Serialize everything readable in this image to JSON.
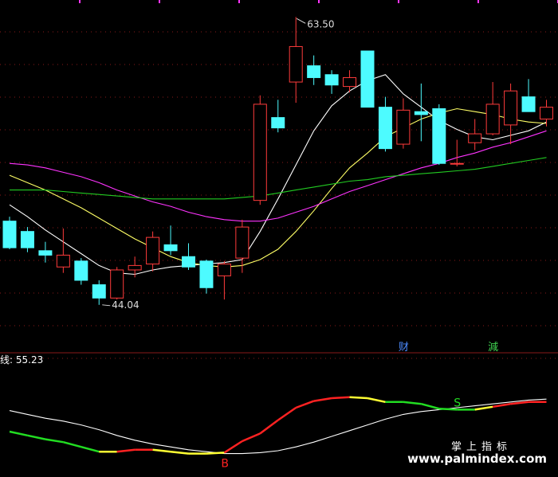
{
  "chart_data": [
    {
      "type": "candlestick",
      "title": "",
      "colors": {
        "up": "#ff3b3b",
        "down": "#4dfbff",
        "ma5": "#ffffff",
        "ma10": "#ffff66",
        "ma20": "#ff33ff",
        "ma60": "#22cc22",
        "grid": "#8a1a1a"
      },
      "annotations": {
        "high_label": "63.50",
        "low_label": "44.04"
      },
      "event_badges": [
        {
          "label": "财",
          "index": 22,
          "color": "#4d8bff"
        },
        {
          "label": "減",
          "index": 27,
          "color": "#3fd04f"
        }
      ],
      "ylim": [
        41.5,
        64.0
      ],
      "candles": [
        {
          "o": 49.7,
          "h": 50.0,
          "l": 47.8,
          "c": 47.9
        },
        {
          "o": 49.0,
          "h": 49.3,
          "l": 47.6,
          "c": 47.9
        },
        {
          "o": 47.7,
          "h": 48.3,
          "l": 46.9,
          "c": 47.4
        },
        {
          "o": 46.6,
          "h": 49.2,
          "l": 46.2,
          "c": 47.4
        },
        {
          "o": 47.0,
          "h": 47.2,
          "l": 45.4,
          "c": 45.7
        },
        {
          "o": 45.4,
          "h": 45.7,
          "l": 44.04,
          "c": 44.5
        },
        {
          "o": 44.5,
          "h": 46.6,
          "l": 44.4,
          "c": 46.4
        },
        {
          "o": 46.4,
          "h": 47.3,
          "l": 45.9,
          "c": 46.7
        },
        {
          "o": 46.8,
          "h": 49.0,
          "l": 46.3,
          "c": 48.6
        },
        {
          "o": 48.1,
          "h": 49.4,
          "l": 47.4,
          "c": 47.7
        },
        {
          "o": 47.3,
          "h": 48.2,
          "l": 46.4,
          "c": 46.6
        },
        {
          "o": 47.0,
          "h": 47.1,
          "l": 44.8,
          "c": 45.2
        },
        {
          "o": 46.0,
          "h": 47.0,
          "l": 44.4,
          "c": 46.8
        },
        {
          "o": 47.2,
          "h": 49.8,
          "l": 46.2,
          "c": 49.3
        },
        {
          "o": 51.1,
          "h": 58.2,
          "l": 50.8,
          "c": 57.6
        },
        {
          "o": 56.7,
          "h": 57.9,
          "l": 55.7,
          "c": 56.0
        },
        {
          "o": 59.1,
          "h": 63.5,
          "l": 57.7,
          "c": 61.5
        },
        {
          "o": 60.2,
          "h": 60.9,
          "l": 58.9,
          "c": 59.4
        },
        {
          "o": 59.6,
          "h": 59.9,
          "l": 58.3,
          "c": 58.9
        },
        {
          "o": 58.8,
          "h": 59.9,
          "l": 58.4,
          "c": 59.4
        },
        {
          "o": 61.2,
          "h": 61.2,
          "l": 57.4,
          "c": 57.4
        },
        {
          "o": 57.4,
          "h": 58.1,
          "l": 54.4,
          "c": 54.6
        },
        {
          "o": 54.9,
          "h": 58.0,
          "l": 54.6,
          "c": 57.2
        },
        {
          "o": 57.1,
          "h": 59.0,
          "l": 55.1,
          "c": 56.9
        },
        {
          "o": 57.3,
          "h": 57.6,
          "l": 53.5,
          "c": 53.6
        },
        {
          "o": 53.6,
          "h": 55.2,
          "l": 53.4,
          "c": 53.6
        },
        {
          "o": 55.0,
          "h": 56.6,
          "l": 54.5,
          "c": 55.6
        },
        {
          "o": 55.6,
          "h": 59.1,
          "l": 55.5,
          "c": 57.6
        },
        {
          "o": 56.2,
          "h": 59.0,
          "l": 54.9,
          "c": 58.5
        },
        {
          "o": 58.1,
          "h": 59.3,
          "l": 57.1,
          "c": 57.1
        },
        {
          "o": 56.6,
          "h": 57.9,
          "l": 56.1,
          "c": 57.4
        }
      ],
      "series": [
        {
          "key": "ma5",
          "values": [
            50.8,
            50.0,
            49.1,
            48.3,
            47.5,
            46.7,
            46.2,
            46.1,
            46.4,
            46.6,
            46.7,
            46.8,
            46.9,
            47.1,
            49.0,
            51.2,
            53.5,
            55.8,
            57.5,
            58.5,
            59.2,
            59.6,
            58.3,
            57.4,
            56.5,
            55.9,
            55.4,
            55.2,
            55.5,
            55.8,
            56.4
          ]
        },
        {
          "key": "ma10",
          "values": [
            52.8,
            52.3,
            51.8,
            51.2,
            50.6,
            49.9,
            49.2,
            48.5,
            47.9,
            47.3,
            46.9,
            46.7,
            46.6,
            46.7,
            47.1,
            47.8,
            49.0,
            50.4,
            51.9,
            53.3,
            54.3,
            55.4,
            56.0,
            56.6,
            57.0,
            57.3,
            57.1,
            56.9,
            56.6,
            56.4,
            56.3
          ]
        },
        {
          "key": "ma20",
          "values": [
            53.6,
            53.5,
            53.3,
            53.0,
            52.7,
            52.3,
            51.8,
            51.4,
            51.0,
            50.7,
            50.3,
            50.0,
            49.8,
            49.7,
            49.7,
            49.9,
            50.3,
            50.7,
            51.2,
            51.7,
            52.1,
            52.5,
            52.9,
            53.3,
            53.6,
            54.0,
            54.3,
            54.7,
            55.0,
            55.4,
            55.8
          ]
        },
        {
          "key": "ma60",
          "values": [
            51.8,
            51.8,
            51.8,
            51.7,
            51.6,
            51.5,
            51.4,
            51.3,
            51.2,
            51.2,
            51.2,
            51.2,
            51.2,
            51.3,
            51.4,
            51.6,
            51.8,
            52.0,
            52.2,
            52.4,
            52.5,
            52.7,
            52.8,
            52.9,
            53.0,
            53.1,
            53.2,
            53.4,
            53.6,
            53.8,
            54.0
          ]
        }
      ]
    },
    {
      "type": "line",
      "title": "",
      "value_label": "线: 55.23",
      "ylim": [
        0,
        100
      ],
      "signals": [
        {
          "label": "B",
          "index": 12,
          "value": 18,
          "color": "#ff2222",
          "position": "below"
        },
        {
          "label": "S",
          "index": 25,
          "value": 63,
          "color": "#22dd22",
          "position": "above"
        }
      ],
      "series": [
        {
          "key": "signal",
          "segment_colors": [
            "#22dd22",
            "#22dd22",
            "#22dd22",
            "#22dd22",
            "#22dd22",
            "#ffff33",
            "#ff2222",
            "#ff2222",
            "#ffff33",
            "#ffff33",
            "#ffff33",
            "#ffff33",
            "#ff2222",
            "#ff2222",
            "#ff2222",
            "#ff2222",
            "#ff2222",
            "#ff2222",
            "#ff2222",
            "#ffff33",
            "#ffff33",
            "#22dd22",
            "#22dd22",
            "#22dd22",
            "#22dd22",
            "#22dd22",
            "#ffff33",
            "#ff2222",
            "#ff2222",
            "#ff2222"
          ],
          "values": [
            40,
            36,
            32,
            29,
            24,
            19,
            19,
            21,
            21,
            19,
            17,
            17,
            18,
            30,
            38,
            52,
            65,
            72,
            75,
            76,
            75,
            71,
            71,
            69,
            64,
            63,
            63,
            66,
            69,
            71,
            71
          ]
        },
        {
          "key": "smooth",
          "color": "#ffffff",
          "values": [
            62,
            58,
            54,
            51,
            47,
            42,
            36,
            31,
            27,
            24,
            21,
            19,
            17,
            17,
            18,
            20,
            24,
            29,
            35,
            41,
            47,
            53,
            58,
            61,
            63,
            65,
            67,
            69,
            71,
            73,
            74
          ]
        }
      ]
    }
  ],
  "watermark": {
    "cn": "掌上指标",
    "url": "www.palmindex.com"
  }
}
